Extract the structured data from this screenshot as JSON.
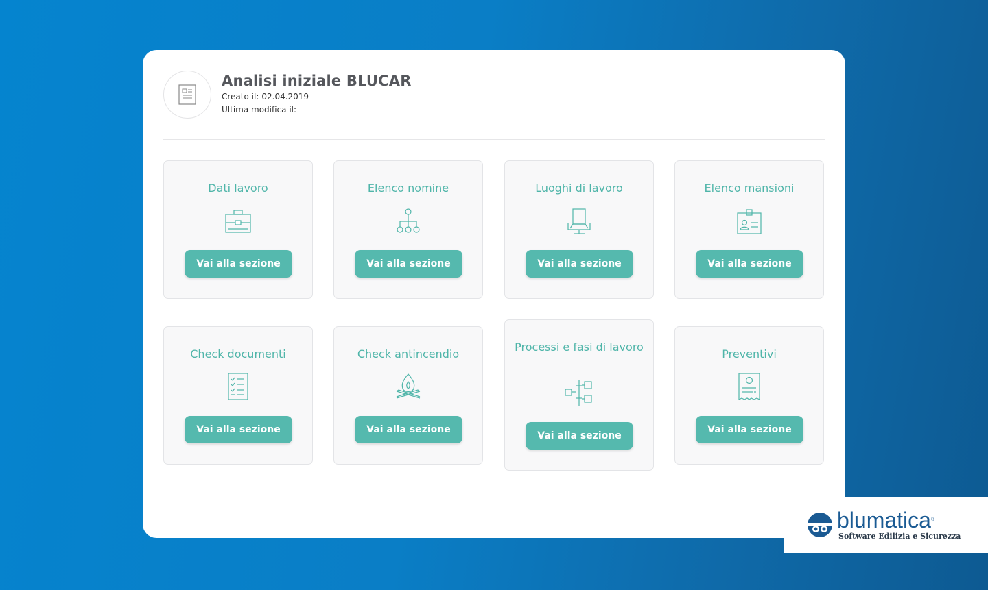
{
  "header": {
    "title": "Analisi iniziale BLUCAR",
    "created_label": "Creato il:",
    "created_value": "02.04.2019",
    "modified_label": "Ultima modifica il:",
    "modified_value": ""
  },
  "cards": [
    {
      "title": "Dati lavoro",
      "icon": "briefcase-icon",
      "button": "Vai alla sezione"
    },
    {
      "title": "Elenco nomine",
      "icon": "org-chart-icon",
      "button": "Vai alla sezione"
    },
    {
      "title": "Luoghi di lavoro",
      "icon": "office-chair-icon",
      "button": "Vai alla sezione"
    },
    {
      "title": "Elenco mansioni",
      "icon": "id-badge-icon",
      "button": "Vai alla sezione"
    },
    {
      "title": "Check documenti",
      "icon": "checklist-icon",
      "button": "Vai alla sezione"
    },
    {
      "title": "Check antincendio",
      "icon": "fire-icon",
      "button": "Vai alla sezione"
    },
    {
      "title": "Processi e fasi di lavoro",
      "icon": "process-flow-icon",
      "button": "Vai alla sezione"
    },
    {
      "title": "Preventivi",
      "icon": "receipt-icon",
      "button": "Vai alla sezione"
    }
  ],
  "logo": {
    "word": "blumatica",
    "registered": "®",
    "tagline": "Software Edilizia e Sicurezza"
  },
  "colors": {
    "accent": "#55b9ae",
    "card_title": "#4fb5a9",
    "logo_blue": "#1a5a93"
  }
}
